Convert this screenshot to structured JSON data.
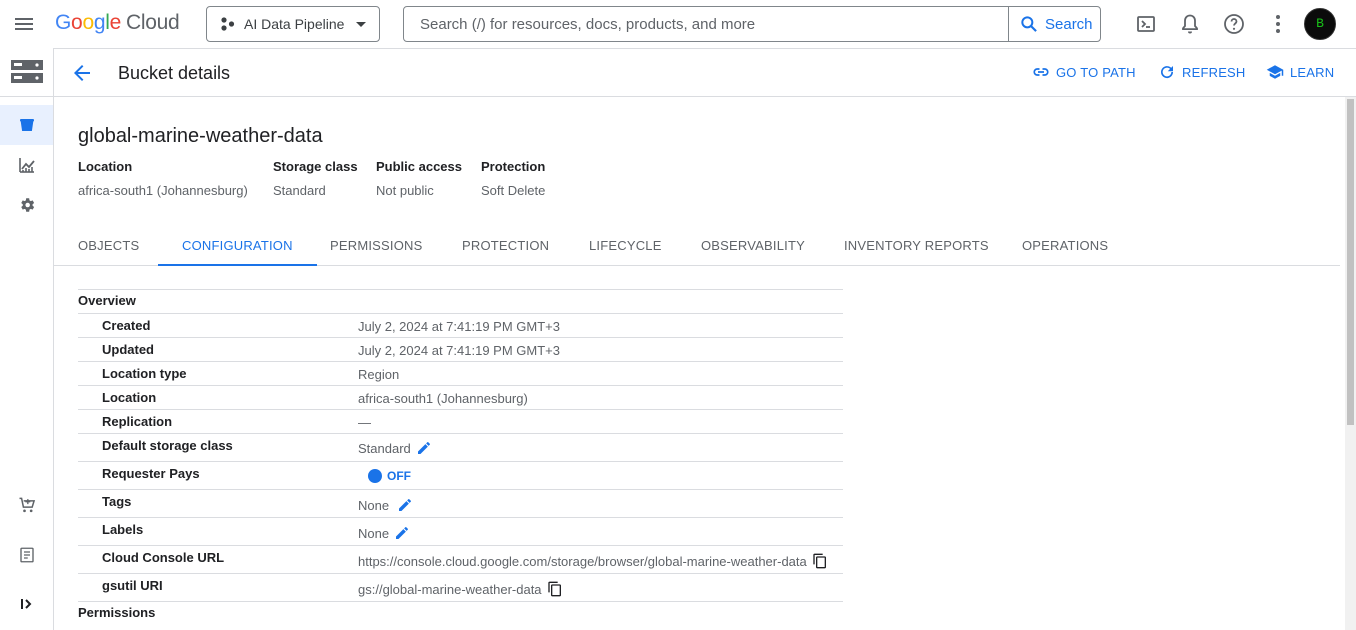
{
  "topbar": {
    "logo_brand": "Google",
    "logo_product": "Cloud",
    "project_name": "AI Data Pipeline",
    "search_placeholder": "Search (/) for resources, docs, products, and more",
    "search_button": "Search",
    "avatar_text": "B"
  },
  "header": {
    "title": "Bucket details",
    "go_to_path": "GO TO PATH",
    "refresh": "REFRESH",
    "learn": "LEARN"
  },
  "bucket": {
    "name": "global-marine-weather-data",
    "meta": [
      {
        "label": "Location",
        "value": "africa-south1 (Johannesburg)"
      },
      {
        "label": "Storage class",
        "value": "Standard"
      },
      {
        "label": "Public access",
        "value": "Not public"
      },
      {
        "label": "Protection",
        "value": "Soft Delete"
      }
    ]
  },
  "tabs": [
    "OBJECTS",
    "CONFIGURATION",
    "PERMISSIONS",
    "PROTECTION",
    "LIFECYCLE",
    "OBSERVABILITY",
    "INVENTORY REPORTS",
    "OPERATIONS"
  ],
  "active_tab": "CONFIGURATION",
  "config": {
    "overview_title": "Overview",
    "permissions_title": "Permissions",
    "rows": [
      {
        "label": "Created",
        "value": "July 2, 2024 at 7:41:19 PM GMT+3"
      },
      {
        "label": "Updated",
        "value": "July 2, 2024 at 7:41:19 PM GMT+3"
      },
      {
        "label": "Location type",
        "value": "Region"
      },
      {
        "label": "Location",
        "value": "africa-south1 (Johannesburg)"
      },
      {
        "label": "Replication",
        "value": "—"
      },
      {
        "label": "Default storage class",
        "value": "Standard"
      },
      {
        "label": "Requester Pays",
        "value": "OFF"
      },
      {
        "label": "Tags",
        "value": "None"
      },
      {
        "label": "Labels",
        "value": "None"
      },
      {
        "label": "Cloud Console URL",
        "value": "https://console.cloud.google.com/storage/browser/global-marine-weather-data"
      },
      {
        "label": "gsutil URI",
        "value": "gs://global-marine-weather-data"
      }
    ]
  },
  "colors": {
    "accent": "#1a73e8",
    "text_secondary": "#5f6368",
    "divider": "#dadce0"
  }
}
